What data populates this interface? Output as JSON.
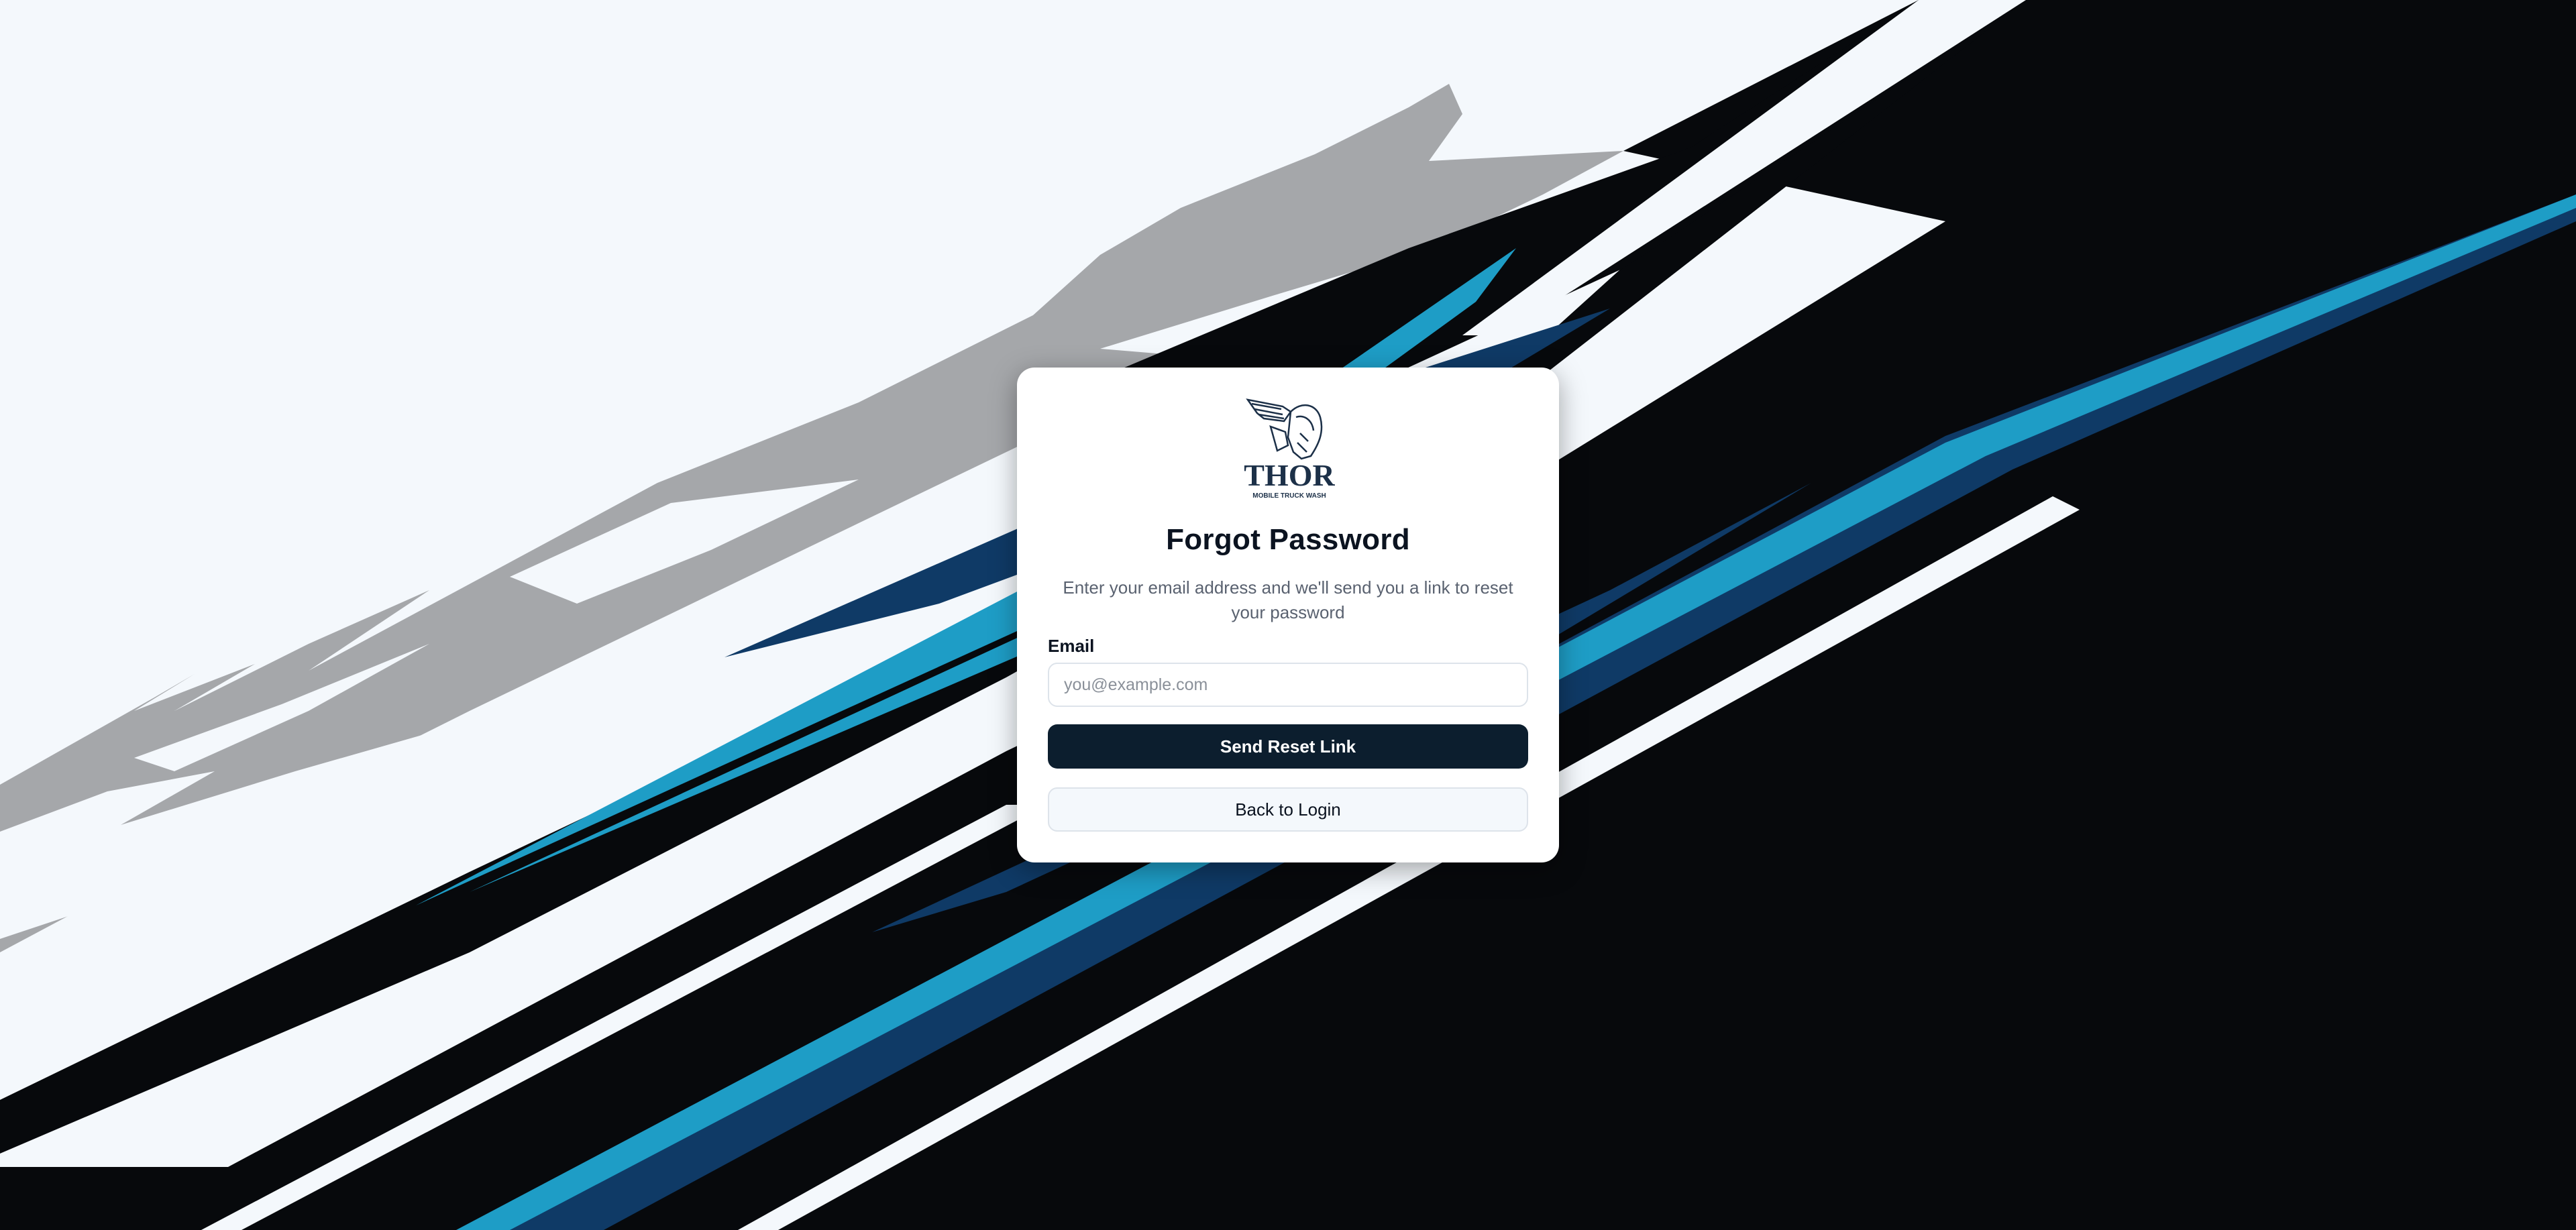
{
  "brand": {
    "name": "THOR",
    "tagline": "MOBILE TRUCK WASH",
    "navy": "#1c3048"
  },
  "colors": {
    "page_bg": "#f4f8fc",
    "dark": "#07090c",
    "gray": "#a5a7aa",
    "cyan": "#1e9dc6",
    "navy_stripe": "#0f3a66",
    "button_primary": "#0c1e2e"
  },
  "form": {
    "title": "Forgot Password",
    "subtitle": "Enter your email address and we'll send you a link to reset your password",
    "email_label": "Email",
    "email_placeholder": "you@example.com",
    "email_value": "",
    "submit_label": "Send Reset Link",
    "back_label": "Back to Login"
  }
}
